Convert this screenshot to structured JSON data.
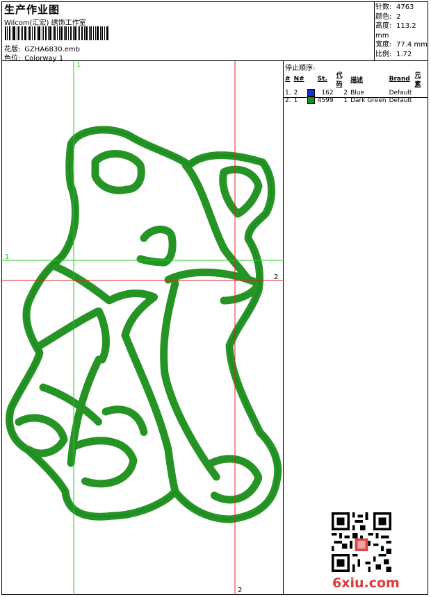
{
  "header": {
    "title": "生产作业图",
    "studio": "Wilcom(汇宏) 绣饰工作室",
    "design_label": "花版:",
    "design_value": "GZHA6830.emb",
    "colorway_label": "色位:",
    "colorway_value": "Colorway 1"
  },
  "stats": {
    "stitches_label": "针数:",
    "stitches_value": "4763",
    "colors_label": "颜色:",
    "colors_value": "2",
    "height_label": "高度:",
    "height_value": "113.2 mm",
    "width_label": "宽度:",
    "width_value": "77.4 mm",
    "scale_label": "比例:",
    "scale_value": "1.72"
  },
  "stop_sequence": {
    "title": "停止顺序:",
    "headers": [
      "#",
      "N#",
      "",
      "St.",
      "代码",
      "描述",
      "Brand",
      "元素"
    ],
    "rows": [
      {
        "num": "1.",
        "needle": "2",
        "color": "#1330d8",
        "stitches": "162",
        "code": "2",
        "desc": "Blue",
        "brand": "Default"
      },
      {
        "num": "2.",
        "needle": "1",
        "color": "#1a8f1a",
        "stitches": "4599",
        "code": "1",
        "desc": "Dark Green",
        "brand": "Default"
      }
    ]
  },
  "guides": {
    "green_label_v": "1",
    "green_label_h": "1",
    "red_label_h": "2",
    "red_label_v": "2",
    "green": "#22cc22",
    "red": "#dd2222"
  },
  "watermark": "6xiu.com"
}
